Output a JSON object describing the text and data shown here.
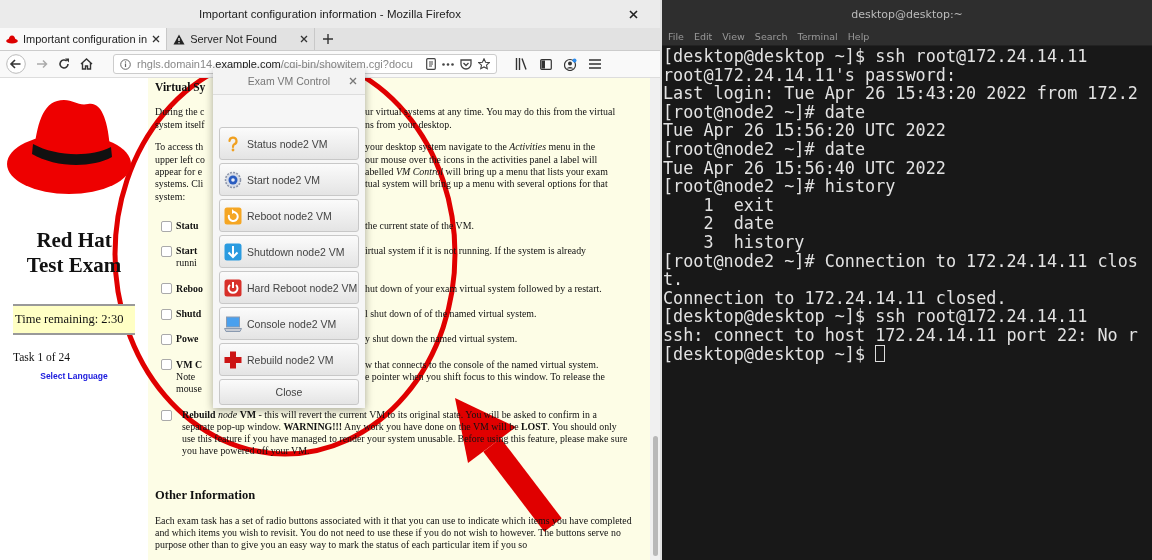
{
  "browser": {
    "title": "Important configuration information - Mozilla Firefox",
    "tabs": [
      {
        "label": "Important configuration in",
        "selected": true,
        "kind": "page"
      },
      {
        "label": "Server Not Found",
        "selected": false,
        "kind": "error"
      }
    ],
    "url": {
      "subdomain": "rhgls.domain14.",
      "domain": "example.com",
      "path": "/cgi-bin/showitem.cgi?docu"
    }
  },
  "sidebar": {
    "title": "Red Hat Test Exam",
    "timer": "Time remaining: 2:30",
    "task": "Task 1 of 24",
    "language_link": "Select Language"
  },
  "document": {
    "heading": "Virtual Sy",
    "paragraphs": [
      [
        {
          "left": "During the c",
          "right": "ur virtual systems at any time. You may do this from the virtual"
        },
        {
          "left": "system itself",
          "right": "ns from your desktop."
        }
      ],
      [
        {
          "left": "To access th",
          "right": "your desktop system navigate to the *Activities* menu in the"
        },
        {
          "left": "upper left co",
          "right": "our mouse over the icons in the activities panel a label will"
        },
        {
          "left": "appear for e",
          "right": "abelled *VM Control* will bring up a menu that lists your exam"
        },
        {
          "left": "systems. Cli",
          "right": "tual system will bring up a menu with several options for that"
        },
        {
          "left": "system:"
        }
      ]
    ],
    "items": [
      {
        "checked": false,
        "lines": [
          {
            "left": "Statu",
            "right": "the current state of the VM."
          }
        ]
      },
      {
        "checked": false,
        "lines": [
          {
            "left": "Start",
            "right": "irtual system if it is not running. If the system is already"
          },
          {
            "left": "runni"
          }
        ]
      },
      {
        "checked": false,
        "lines": [
          {
            "left": "Reboo",
            "right": "hut down of your exam virtual system followed by a restart."
          }
        ]
      },
      {
        "checked": false,
        "lines": [
          {
            "left": "Shutd",
            "right": "l shut down of of the named virtual system."
          }
        ]
      },
      {
        "checked": false,
        "lines": [
          {
            "left": "Powe",
            "right": "y shut down the named virtual system."
          }
        ]
      },
      {
        "checked": false,
        "lines": [
          {
            "left": "VM C",
            "right": "w that connects to the console of the named virtual system."
          },
          {
            "left": "Note",
            "right": "e pointer when you shift focus to this window. To release the"
          },
          {
            "left": "mouse"
          }
        ]
      }
    ],
    "rebuild_item": {
      "checked": false,
      "text": "**Rebuild** *node* **VM** - this will revert the current VM to its original state. You will be asked to confirm in a separate pop-up window. **WARNING!!!** Any work you have done on the VM will be **LOST**. You should only use this feature if you have managed to render your system unusable. Before using this feature, please make sure you have powered off your VM."
    },
    "other_heading": "Other Information",
    "other_text": "Each exam task has a set of radio buttons associated with it that you can use to indicate which items you have completed and which items you wish to revisit. You do not need to use these if you do not wish to however. The buttons serve no purpose other than to give you an easy way to mark the status of each particular item if you so"
  },
  "dialog": {
    "title": "Exam VM Control",
    "buttons": [
      {
        "label": "Status node2 VM",
        "kind": "status"
      },
      {
        "label": "Start node2 VM",
        "kind": "start"
      },
      {
        "label": "Reboot node2 VM",
        "kind": "reboot"
      },
      {
        "label": "Shutdown node2 VM",
        "kind": "shutdown"
      },
      {
        "label": "Hard Reboot node2 VM",
        "kind": "hard_reboot"
      },
      {
        "label": "Console node2 VM",
        "kind": "console"
      },
      {
        "label": "Rebuild node2 VM",
        "kind": "rebuild"
      }
    ],
    "close": "Close"
  },
  "terminal": {
    "title": "desktop@desktop:~",
    "menu": [
      "File",
      "Edit",
      "View",
      "Search",
      "Terminal",
      "Help"
    ],
    "lines": [
      "[desktop@desktop ~]$ ssh root@172.24.14.11",
      "root@172.24.14.11's password:",
      "Last login: Tue Apr 26 15:43:20 2022 from 172.2",
      "[root@node2 ~]# date",
      "Tue Apr 26 15:56:20 UTC 2022",
      "[root@node2 ~]# date",
      "Tue Apr 26 15:56:40 UTC 2022",
      "[root@node2 ~]# history",
      "    1  exit",
      "    2  date",
      "    3  history",
      "[root@node2 ~]# Connection to 172.24.14.11 clos",
      "t.",
      "Connection to 172.24.14.11 closed.",
      "[desktop@desktop ~]$ ssh root@172.24.14.11",
      "ssh: connect to host 172.24.14.11 port 22: No r",
      "[desktop@desktop ~]$ "
    ]
  }
}
